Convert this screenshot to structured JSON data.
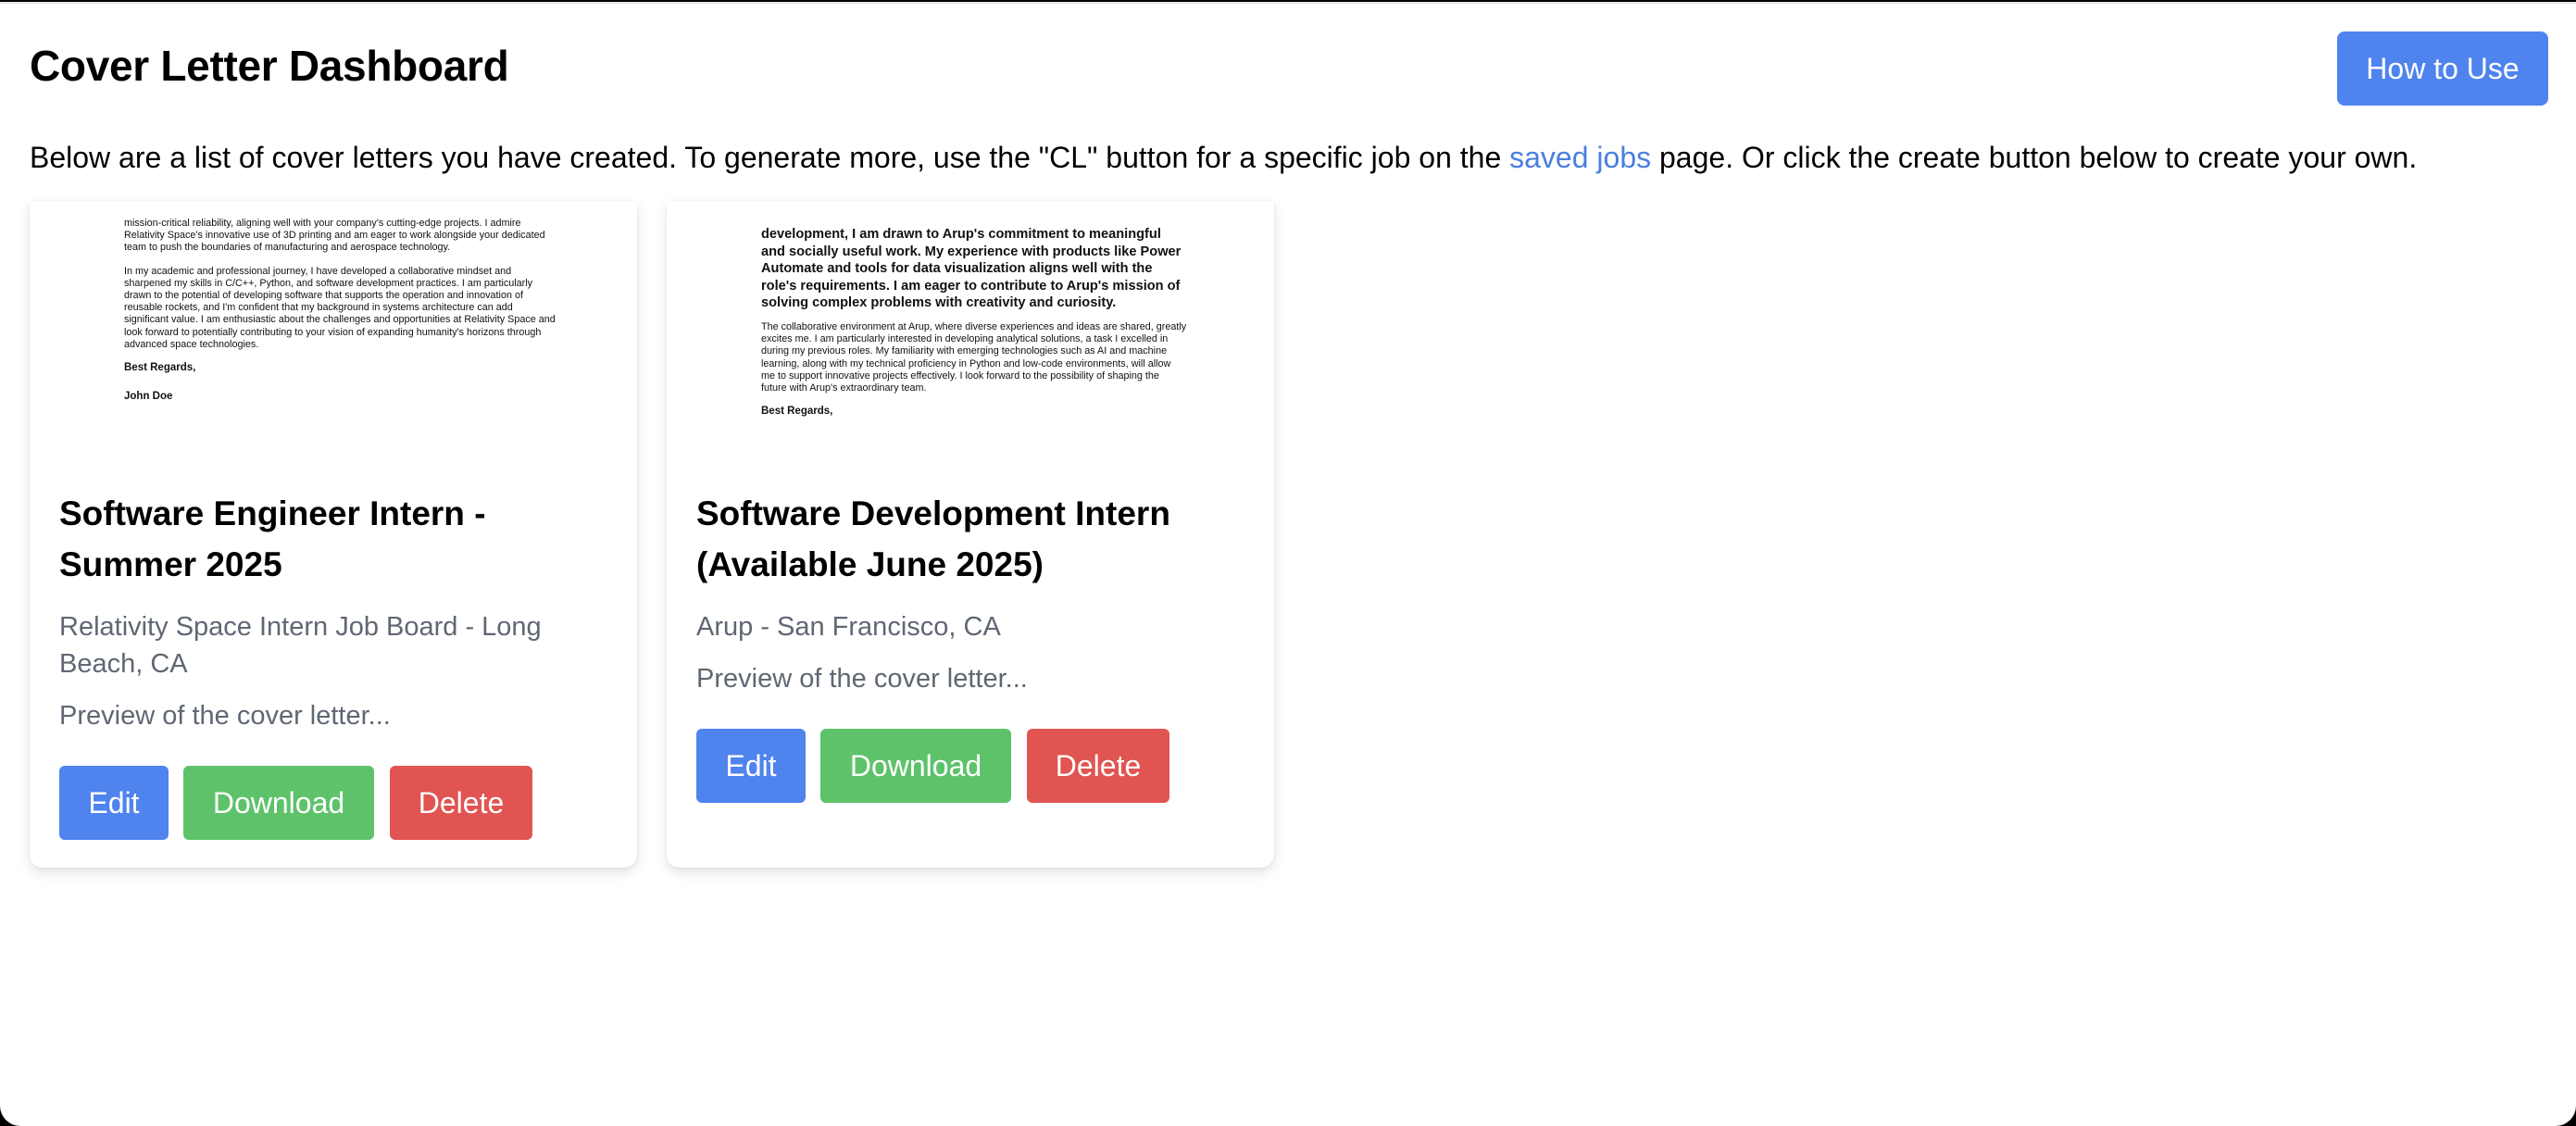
{
  "header": {
    "title": "Cover Letter Dashboard",
    "how_to_use_label": "How to Use"
  },
  "intro": {
    "text_before": "Below are a list of cover letters you have created. To generate more, use the \"CL\" button for a specific job on the ",
    "link_text": "saved jobs",
    "text_after": " page. Or click the create button below to create your own."
  },
  "cards": [
    {
      "preview": {
        "p1": "mission-critical reliability, aligning well with your company's cutting-edge projects. I admire Relativity Space's innovative use of 3D printing and am eager to work alongside your dedicated team to push the boundaries of manufacturing and aerospace technology.",
        "p2": "In my academic and professional journey, I have developed a collaborative mindset and sharpened my skills in C/C++, Python, and software development practices. I am particularly drawn to the potential of developing software that supports the operation and innovation of reusable rockets, and I'm confident that my background in systems architecture can add significant value. I am enthusiastic about the challenges and opportunities at Relativity Space and look forward to potentially contributing to your vision of expanding humanity's horizons through advanced space technologies.",
        "closing": "Best Regards,",
        "signature": "John Doe"
      },
      "title": "Software Engineer Intern - Summer 2025",
      "company": "Relativity Space Intern Job Board - Long Beach, CA",
      "preview_text": "Preview of the cover letter...",
      "edit_label": "Edit",
      "download_label": "Download",
      "delete_label": "Delete"
    },
    {
      "preview": {
        "p1": "development, I am drawn to Arup's commitment to meaningful and socially useful work. My experience with products like Power Automate and tools for data visualization aligns well with the role's requirements. I am eager to contribute to Arup's mission of solving complex problems with creativity and curiosity.",
        "p2": "The collaborative environment at Arup, where diverse experiences and ideas are shared, greatly excites me. I am particularly interested in developing analytical solutions, a task I excelled in during my previous roles. My familiarity with emerging technologies such as AI and machine learning, along with my technical proficiency in Python and low-code environments, will allow me to support innovative projects effectively. I look forward to the possibility of shaping the future with Arup's extraordinary team.",
        "closing": "Best Regards,"
      },
      "title": "Software Development Intern (Available June 2025)",
      "company": "Arup - San Francisco, CA",
      "preview_text": "Preview of the cover letter...",
      "edit_label": "Edit",
      "download_label": "Download",
      "delete_label": "Delete"
    }
  ],
  "colors": {
    "primary": "#4f83ee",
    "success": "#5ec26a",
    "danger": "#e05451",
    "link": "#4a7fe0",
    "muted_text": "#5f6773"
  }
}
